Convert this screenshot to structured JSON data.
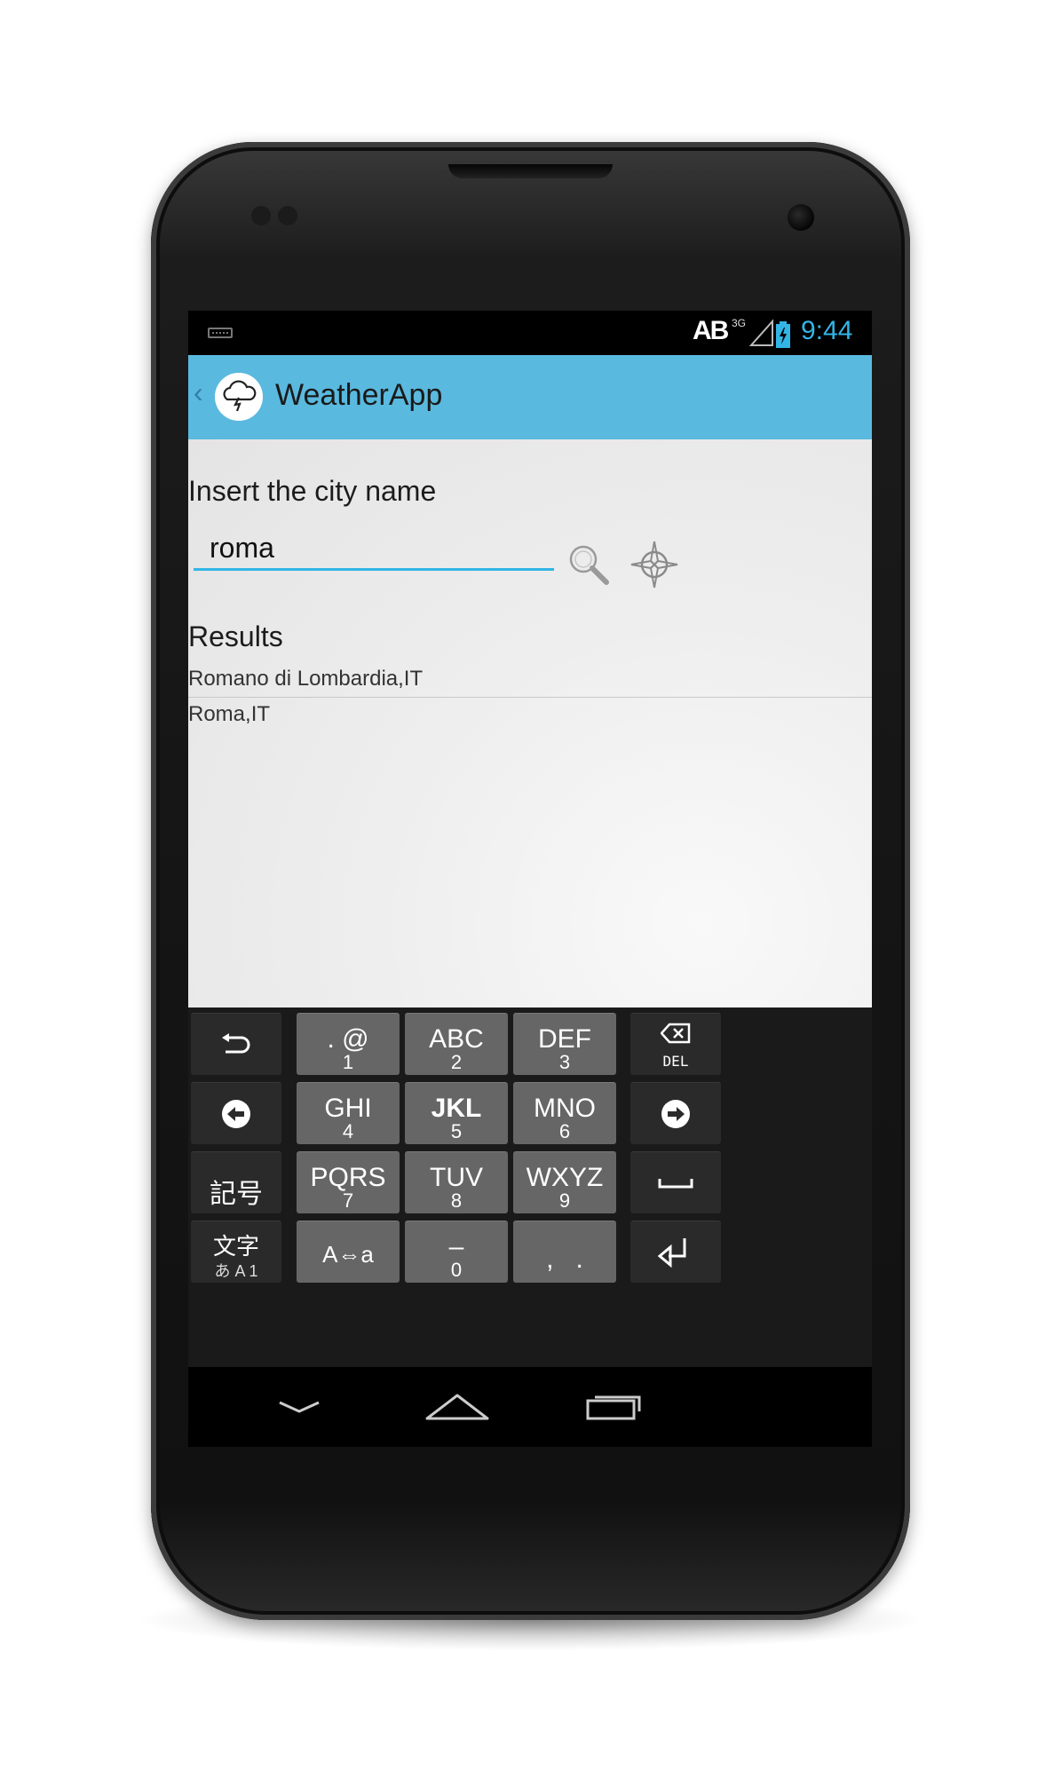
{
  "status_bar": {
    "time": "9:44",
    "network_type": "3G",
    "notification_icon": "ab-icon",
    "keyboard_icon": "keyboard-icon",
    "accent_color": "#33b5e5"
  },
  "action_bar": {
    "title": "WeatherApp",
    "up_icon": "chevron-left-icon",
    "app_icon": "cloud-lightning-icon",
    "background_color": "#5ab9de"
  },
  "main": {
    "prompt": "Insert the city name",
    "city_input_value": "roma",
    "search_icon": "search-icon",
    "locate_icon": "crosshair-icon",
    "results_heading": "Results",
    "results": [
      "Romano di Lombardia,IT",
      "Roma,IT"
    ]
  },
  "keyboard": {
    "left_keys": [
      {
        "name": "undo-key",
        "icon": "undo-icon"
      },
      {
        "name": "cursor-left-key",
        "icon": "arrow-left-circle-icon"
      },
      {
        "name": "symbols-key",
        "label": "記号"
      },
      {
        "name": "input-mode-key",
        "label": "文字",
        "sub_label": "あ A 1"
      }
    ],
    "center_keys": [
      {
        "main": ". @",
        "sub": "1"
      },
      {
        "main": "ABC",
        "sub": "2"
      },
      {
        "main": "DEF",
        "sub": "3"
      },
      {
        "main": "GHI",
        "sub": "4"
      },
      {
        "main": "JKL",
        "sub": "5"
      },
      {
        "main": "MNO",
        "sub": "6"
      },
      {
        "main": "PQRS",
        "sub": "7"
      },
      {
        "main": "TUV",
        "sub": "8"
      },
      {
        "main": "WXYZ",
        "sub": "9"
      },
      {
        "main": "A⇔a",
        "sub": ""
      },
      {
        "main": "–",
        "sub": "0"
      },
      {
        "main": ",   .",
        "sub": ""
      }
    ],
    "right_keys": [
      {
        "name": "delete-key",
        "icon": "backspace-icon",
        "label": "DEL"
      },
      {
        "name": "cursor-right-key",
        "icon": "arrow-right-circle-icon"
      },
      {
        "name": "space-key",
        "icon": "space-icon"
      },
      {
        "name": "enter-key",
        "icon": "enter-icon"
      }
    ]
  },
  "nav_bar": {
    "back_icon": "chevron-down-icon",
    "home_icon": "home-icon",
    "recents_icon": "recents-icon"
  }
}
